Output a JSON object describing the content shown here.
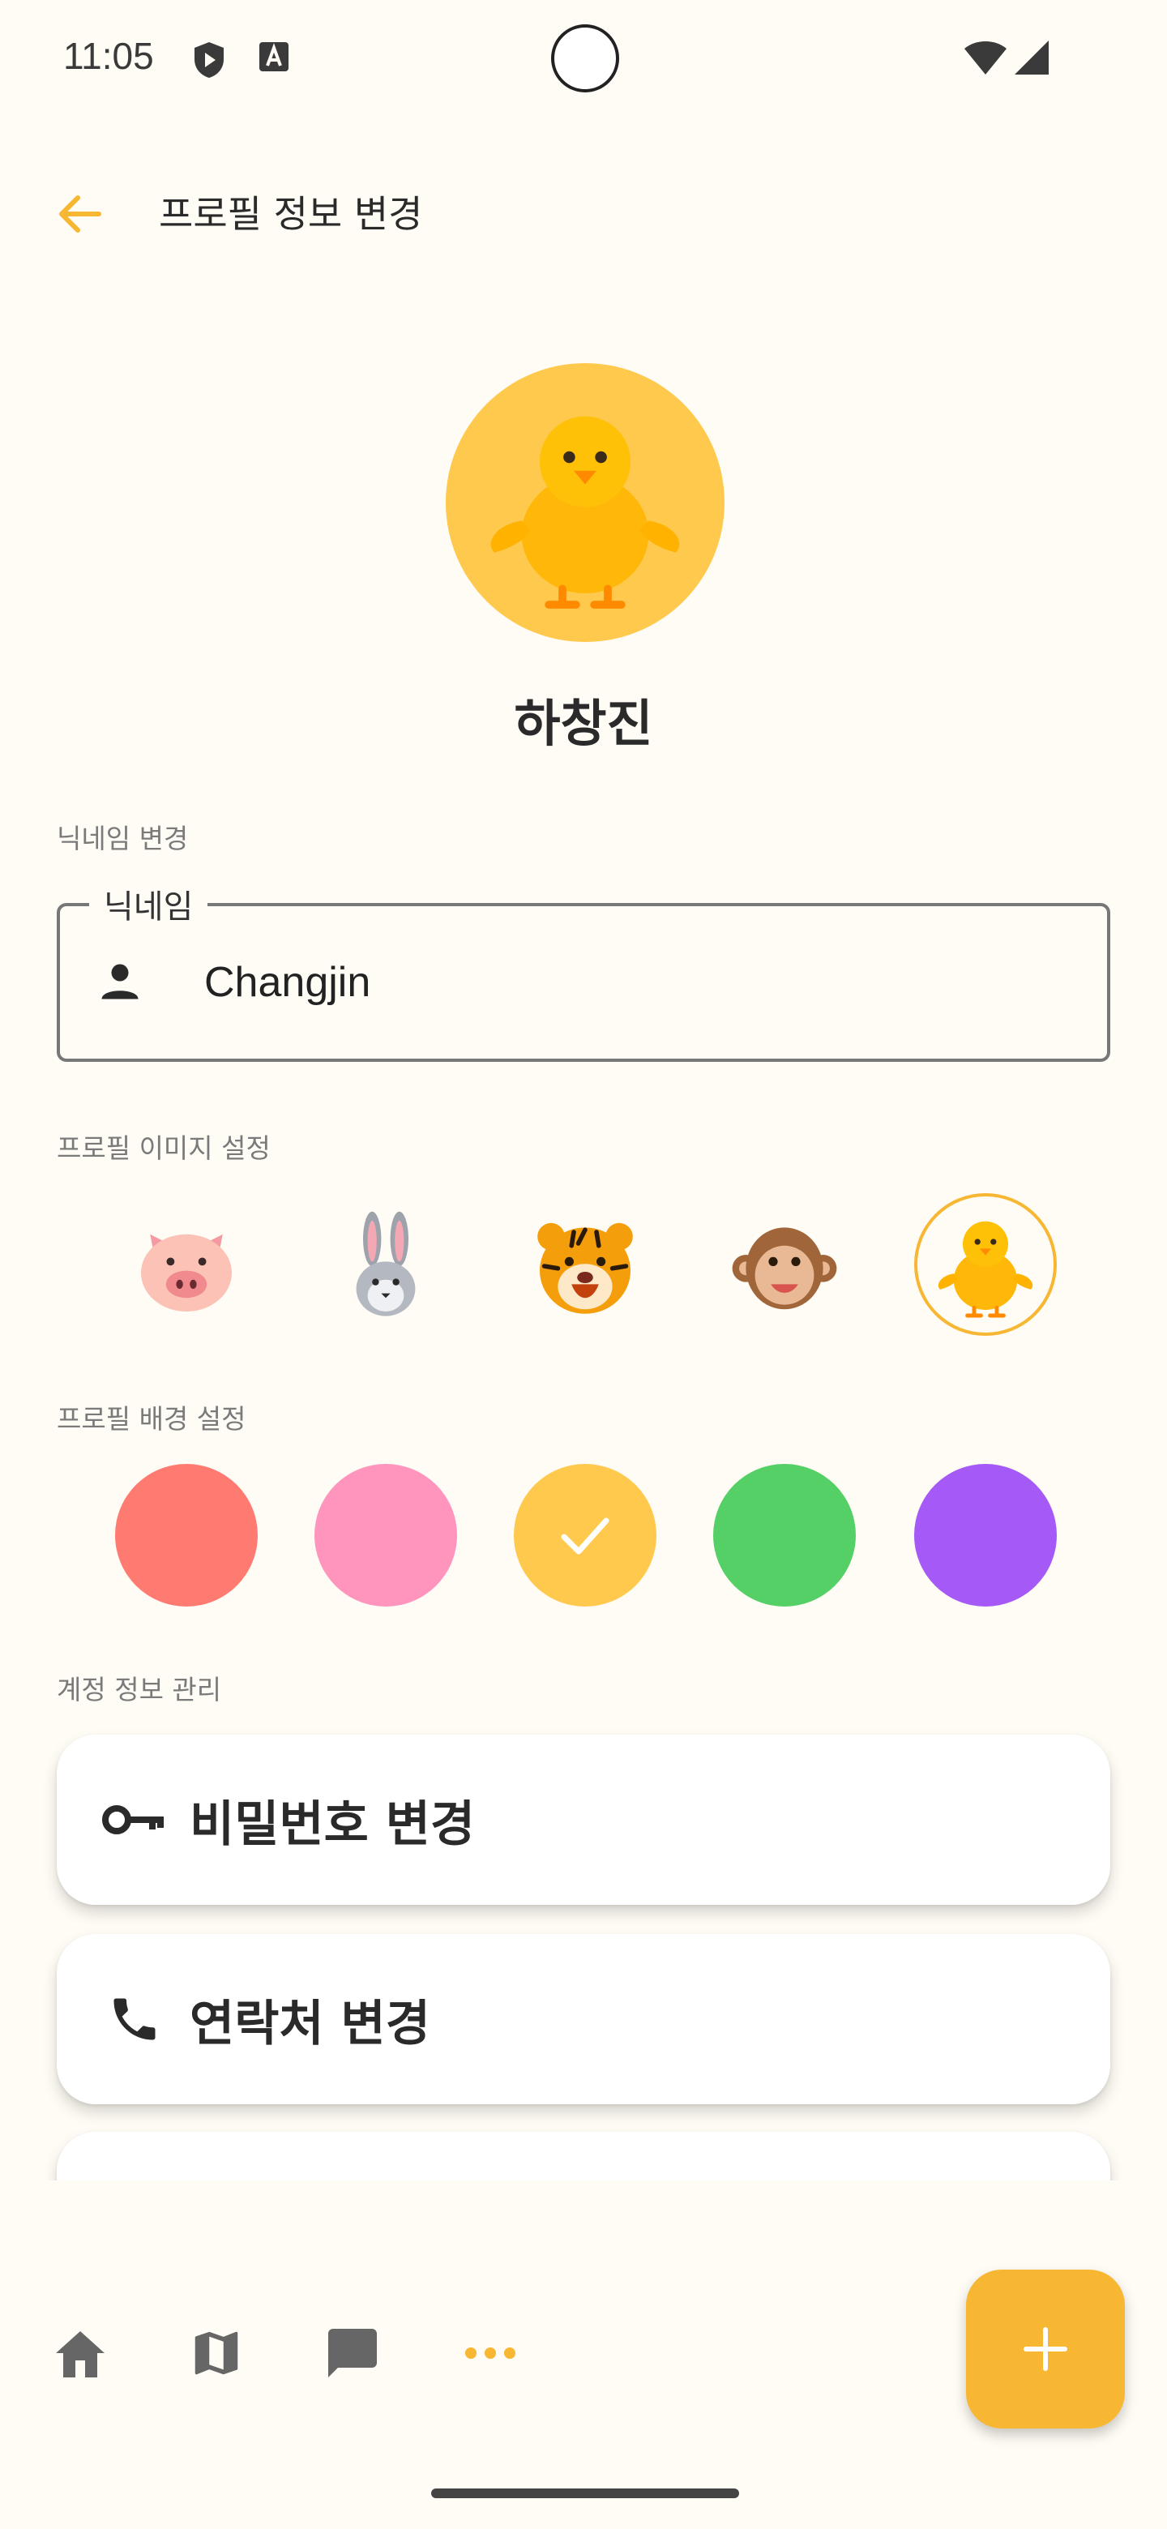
{
  "status_bar": {
    "time": "11:05"
  },
  "header": {
    "title": "프로필 정보 변경"
  },
  "profile": {
    "name": "하창진",
    "avatar_emoji": "chick",
    "avatar_bg": "#ffc94d"
  },
  "nickname_section": {
    "label": "닉네임 변경",
    "field_label": "닉네임",
    "value": "Changjin"
  },
  "image_section": {
    "label": "프로필 이미지 설정",
    "options": [
      "pig",
      "rabbit",
      "tiger",
      "monkey",
      "chick"
    ],
    "selected": "chick"
  },
  "background_section": {
    "label": "프로필 배경 설정",
    "colors": [
      "#ff7b72",
      "#ff94bd",
      "#ffc94d",
      "#55d066",
      "#a55af7"
    ],
    "selected_color": "#ffc94d"
  },
  "account_section": {
    "label": "계정 정보 관리",
    "items": [
      {
        "label": "비밀번호 변경",
        "icon": "key-icon"
      },
      {
        "label": "연락처 변경",
        "icon": "phone-icon"
      }
    ]
  },
  "colors": {
    "accent": "#f7b733",
    "background": "#fffcf5"
  },
  "bottom_nav": {
    "items": [
      "home-icon",
      "map-icon",
      "chat-icon",
      "more-icon"
    ],
    "active": "more-icon",
    "fab_icon": "plus-icon"
  }
}
